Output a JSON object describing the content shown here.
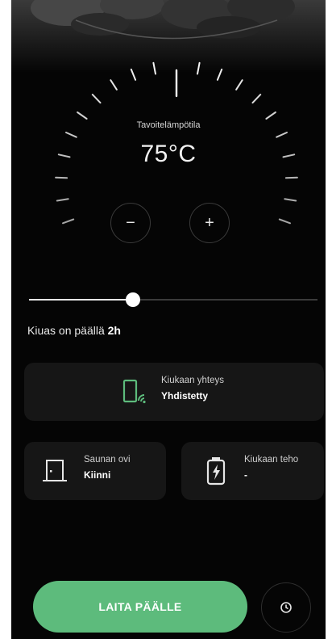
{
  "heater": {
    "target_label": "Tavoitelämpötila",
    "target_value": "75°C",
    "minus_label": "−",
    "plus_label": "+",
    "on_text": "Kiuas on päällä ",
    "duration": "2h",
    "timer_fraction": 0.36
  },
  "connection": {
    "title": "Kiukaan yhteys",
    "value": "Yhdistetty"
  },
  "door": {
    "title": "Saunan ovi",
    "value": "Kiinni"
  },
  "power": {
    "title": "Kiukaan teho",
    "value": "-"
  },
  "actions": {
    "start_label": "LAITA PÄÄLLE"
  },
  "icons": {
    "connection": "heater-connection-icon",
    "door": "door-icon",
    "power": "heater-power-icon",
    "timer": "clock-icon"
  },
  "colors": {
    "accent": "#5dbb7c",
    "background": "#050505",
    "card": "#161616"
  }
}
